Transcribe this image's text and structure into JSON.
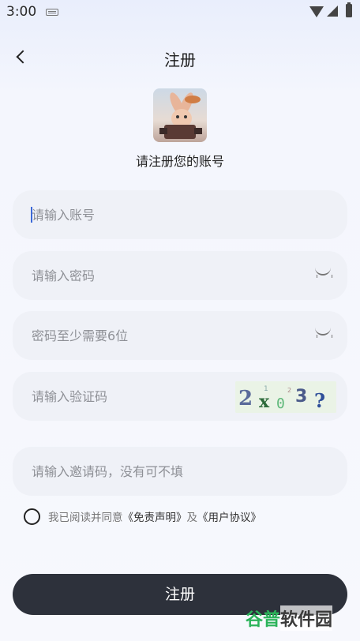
{
  "status_bar": {
    "time": "3:00"
  },
  "header": {
    "title": "注册"
  },
  "subtitle": "请注册您的账号",
  "fields": {
    "account": {
      "placeholder": "请输入账号",
      "value": ""
    },
    "password": {
      "placeholder": "请输入密码",
      "value": ""
    },
    "confirm_password": {
      "placeholder": "密码至少需要6位",
      "value": ""
    },
    "captcha": {
      "placeholder": "请输入验证码",
      "value": "",
      "image_text": "2 x 0 3 ?"
    },
    "invite": {
      "placeholder": "请输入邀请码，没有可不填",
      "value": ""
    }
  },
  "agreement": {
    "prefix": "我已阅读并同意",
    "link1": "《免责声明》",
    "joiner": "及",
    "link2": "《用户协议》",
    "checked": false
  },
  "submit_label": "注册",
  "watermark": {
    "part1": "谷普",
    "part2": "软件园"
  },
  "icons": [
    "keyboard-icon",
    "wifi-icon",
    "signal-icon",
    "battery-icon",
    "back-arrow-icon",
    "eye-closed-icon",
    "radio-icon"
  ]
}
